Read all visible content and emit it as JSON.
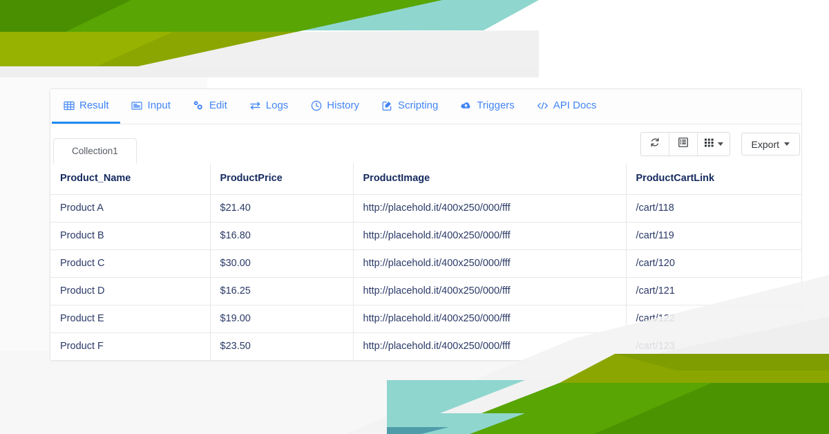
{
  "window": {
    "title": "Result"
  },
  "tabs": [
    {
      "label": "Result",
      "icon": "table-grid-icon",
      "active": true
    },
    {
      "label": "Input",
      "icon": "form-input-icon",
      "active": false
    },
    {
      "label": "Edit",
      "icon": "gears-icon",
      "active": false
    },
    {
      "label": "Logs",
      "icon": "exchange-icon",
      "active": false
    },
    {
      "label": "History",
      "icon": "clock-icon",
      "active": false
    },
    {
      "label": "Scripting",
      "icon": "pencil-square-icon",
      "active": false
    },
    {
      "label": "Triggers",
      "icon": "cloud-upload-icon",
      "active": false
    },
    {
      "label": "API Docs",
      "icon": "code-icon",
      "active": false
    }
  ],
  "collection_tabs": [
    {
      "label": "Collection1",
      "active": true
    }
  ],
  "toolbar": {
    "refresh_icon": "refresh-icon",
    "detail_view_icon": "list-view-icon",
    "grid_view_icon": "grid-view-icon",
    "export_label": "Export",
    "export_caret": "caret-down-icon"
  },
  "table": {
    "columns": [
      "Product_Name",
      "ProductPrice",
      "ProductImage",
      "ProductCartLink"
    ],
    "rows": [
      [
        "Product A",
        "$21.40",
        "http://placehold.it/400x250/000/fff",
        "/cart/118"
      ],
      [
        "Product B",
        "$16.80",
        "http://placehold.it/400x250/000/fff",
        "/cart/119"
      ],
      [
        "Product C",
        "$30.00",
        "http://placehold.it/400x250/000/fff",
        "/cart/120"
      ],
      [
        "Product D",
        "$16.25",
        "http://placehold.it/400x250/000/fff",
        "/cart/121"
      ],
      [
        "Product E",
        "$19.00",
        "http://placehold.it/400x250/000/fff",
        "/cart/122"
      ],
      [
        "Product F",
        "$23.50",
        "http://placehold.it/400x250/000/fff",
        "/cart/123"
      ]
    ]
  },
  "colors": {
    "accent_blue": "#4285f4",
    "active_underline": "#1f8cf4",
    "header_text": "#14295e",
    "cell_text": "#2b3a67",
    "deco_green": "#5aa700",
    "deco_green_dark": "#4a9000",
    "deco_olive": "#8fa800",
    "deco_teal": "#8fd6cf",
    "card_border": "#e7e7e7"
  }
}
